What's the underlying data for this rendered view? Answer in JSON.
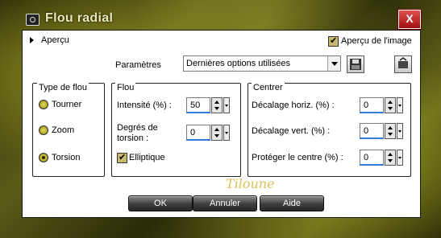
{
  "window": {
    "title": "Flou radial",
    "close_label": "X"
  },
  "preview": {
    "label": "Aperçu"
  },
  "image_preview": {
    "label": "Aperçu de l'image",
    "checked": true
  },
  "parameters": {
    "label": "Paramètres",
    "selected": "Dernières options utilisées"
  },
  "blur_type": {
    "title": "Type de flou",
    "options": [
      {
        "label": "Tourner",
        "selected": false
      },
      {
        "label": "Zoom",
        "selected": false
      },
      {
        "label": "Torsion",
        "selected": true
      }
    ]
  },
  "blur": {
    "title": "Flou",
    "intensity_label": "Intensité (%) :",
    "intensity_value": "50",
    "torsion_label_line1": "Degrés de",
    "torsion_label_line2": "torsion :",
    "torsion_value": "0",
    "elliptic_label": "Elliptique",
    "elliptic_checked": true
  },
  "center": {
    "title": "Centrer",
    "h_offset_label": "Décalage horiz. (%) :",
    "h_offset_value": "0",
    "v_offset_label": "Décalage vert. (%) :",
    "v_offset_value": "0",
    "protect_label": "Protéger le centre (%) :",
    "protect_value": "0"
  },
  "watermark": "Tiloune",
  "buttons": {
    "ok": "OK",
    "cancel": "Annuler",
    "help": "Aide"
  }
}
